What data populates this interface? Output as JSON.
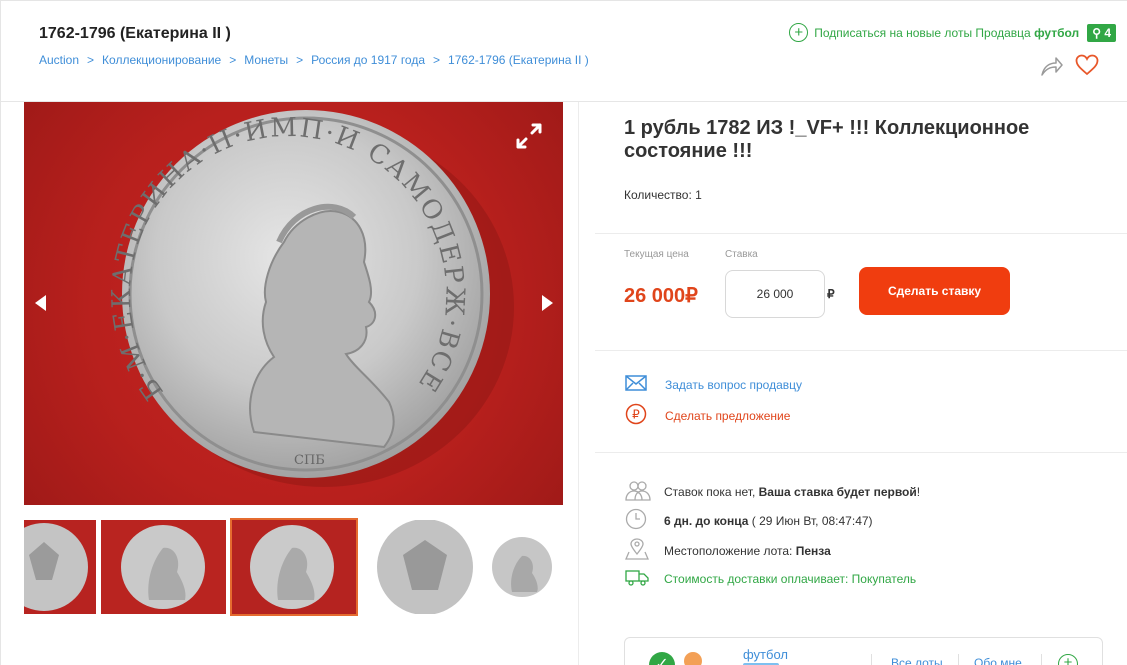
{
  "header": {
    "title": "1762-1796 (Екатерина II )",
    "breadcrumbs": [
      "Auction",
      "Коллекционирование",
      "Монеты",
      "Россия до 1917 года",
      "1762-1796 (Екатерина II )"
    ],
    "subscribe_text": "Подписаться на новые лоты Продавца",
    "subscribe_seller": "футбол",
    "seller_rating": "4"
  },
  "gallery": {
    "coin_legend": "Б·М·ЕКАТЕРИНА·II·ИМП·И САМОДЕРЖ·ВСЕРОСС·",
    "mint_mark": "СПБ",
    "thumbnails": [
      "thumb-1",
      "thumb-2",
      "thumb-3",
      "thumb-4",
      "thumb-5"
    ],
    "selected_thumbnail": 3
  },
  "lot": {
    "title": "1 рубль 1782 ИЗ !_VF+ !!! Коллекционное состояние !!!",
    "quantity": "Количество: 1",
    "current_price_label": "Текущая цена",
    "current_price": "26 000₽",
    "bid_label": "Ставка",
    "bid_value": "26 000",
    "bid_currency": "₽",
    "bid_button": "Сделать ставку"
  },
  "actions": {
    "ask_seller": "Задать вопрос продавцу",
    "make_offer": "Сделать предложение"
  },
  "info": {
    "bids_text": "Ставок пока нет, ",
    "bids_bold": "Ваша ставка будет первой",
    "bids_end": "!",
    "time_bold": "6 дн. до конца",
    "time_rest": " ( 29 Июн Вт, 08:47:47)",
    "location_label": "Местоположение лота: ",
    "location_value": "Пенза",
    "delivery": "Стоимость доставки оплачивает: Покупатель"
  },
  "seller": {
    "name": "футбол",
    "all_lots": "Все лоты",
    "about": "Обо мне"
  },
  "colors": {
    "accent_green": "#31a745",
    "price_red": "#e0451b",
    "button_orange": "#f03d0f",
    "link_blue": "#3f8ed8"
  }
}
